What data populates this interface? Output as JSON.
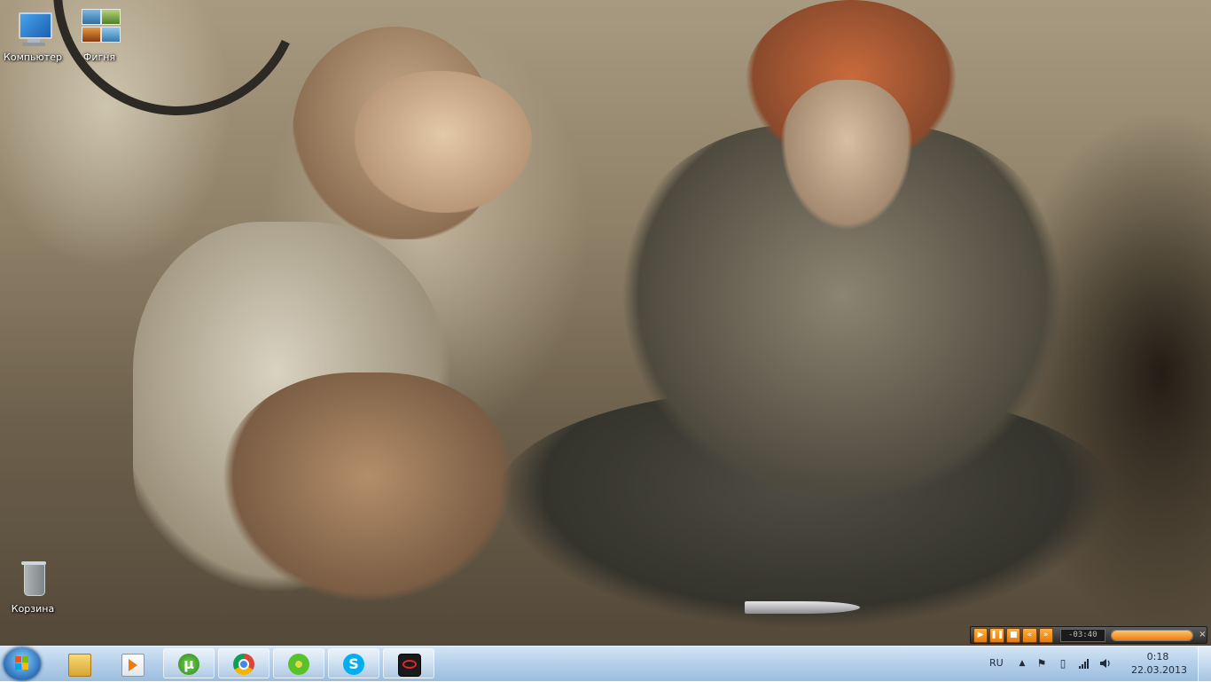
{
  "desktop": {
    "icons": [
      {
        "label": "Компьютер",
        "icon": "computer-icon"
      },
      {
        "label": "Фигня",
        "icon": "pictures-folder-icon"
      },
      {
        "label": "Корзина",
        "icon": "recycle-bin-icon"
      }
    ]
  },
  "player": {
    "buttons": [
      "play",
      "pause",
      "stop",
      "previous",
      "next"
    ],
    "time": "-03:40",
    "progress": 1.0
  },
  "taskbar": {
    "pinned": [
      {
        "name": "explorer",
        "icon": "folder-icon",
        "active": false
      },
      {
        "name": "media-player",
        "icon": "media-player-icon",
        "active": false
      },
      {
        "name": "utorrent",
        "icon": "utorrent-icon",
        "active": true
      },
      {
        "name": "chrome",
        "icon": "chrome-icon",
        "active": true
      },
      {
        "name": "icq",
        "icon": "icq-flower-icon",
        "active": true
      },
      {
        "name": "skype",
        "icon": "skype-icon",
        "active": true
      },
      {
        "name": "garena",
        "icon": "garena-icon",
        "active": true
      }
    ],
    "tray": {
      "language": "RU",
      "time": "0:18",
      "date": "22.03.2013"
    }
  },
  "colors": {
    "taskbar": "#b0cce8",
    "player_accent": "#f07a10"
  }
}
